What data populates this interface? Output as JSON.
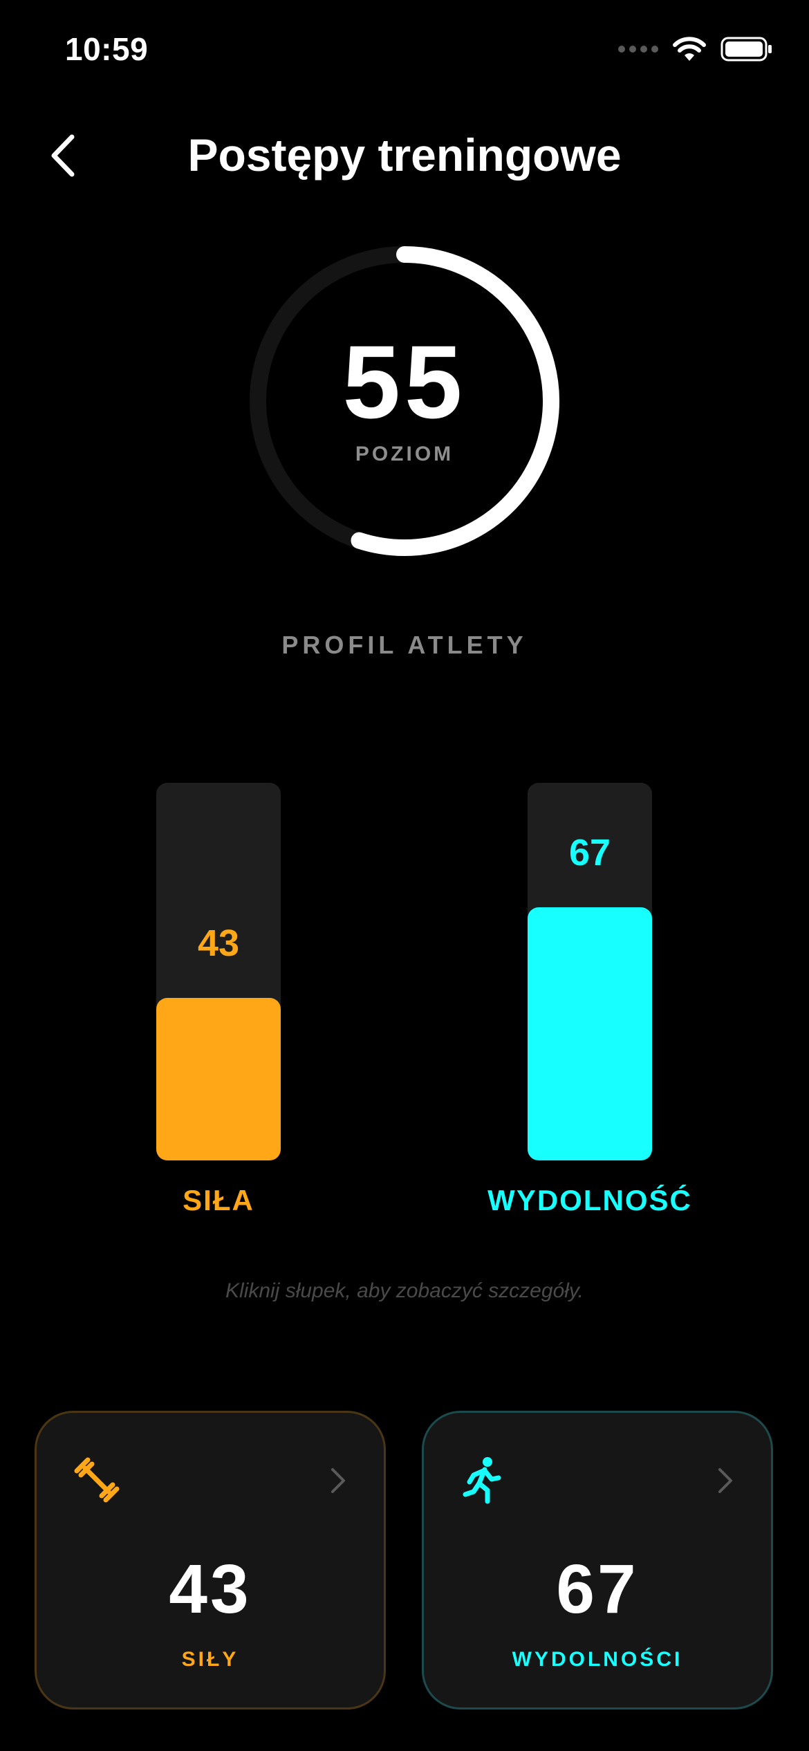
{
  "status_bar": {
    "time": "10:59"
  },
  "header": {
    "title": "Postępy treningowe",
    "back_icon": "chevron-left-icon"
  },
  "level": {
    "value": "55",
    "label": "POZIOM",
    "progress_fraction": 0.55
  },
  "section": {
    "title": "PROFIL ATLETY"
  },
  "chart_data": {
    "type": "bar",
    "categories": [
      "SIŁA",
      "WYDOLNOŚĆ"
    ],
    "values": [
      43,
      67
    ],
    "ylim": [
      0,
      100
    ],
    "colors": [
      "#FFA716",
      "#17FFFF"
    ]
  },
  "hint": "Kliknij słupek, aby zobaczyć szczegóły.",
  "cards": [
    {
      "value": "43",
      "label": "SIŁY",
      "icon": "dumbbell-icon",
      "accent": "#FFA716",
      "border": "#4a3515"
    },
    {
      "value": "67",
      "label": "WYDOLNOŚCI",
      "icon": "runner-icon",
      "accent": "#17FFFF",
      "border": "#1c4a4d"
    }
  ],
  "colors": {
    "background": "#000000",
    "ring_track": "#141414",
    "ring_progress": "#FFFFFF",
    "bar_track": "#1E1E1E"
  }
}
